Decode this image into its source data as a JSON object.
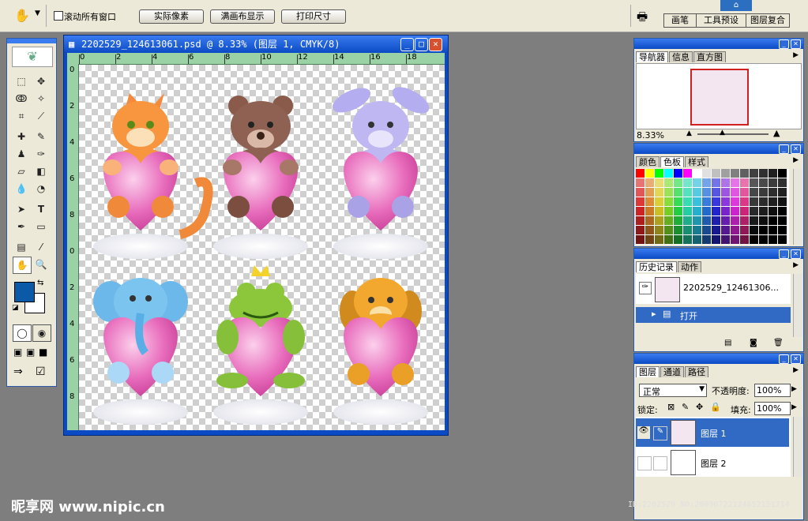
{
  "options_bar": {
    "checkbox_label": "滚动所有窗口",
    "buttons": [
      "实际像素",
      "满画布显示",
      "打印尺寸"
    ],
    "well_tabs": [
      "画笔",
      "工具预设",
      "图层复合"
    ]
  },
  "document": {
    "title": "2202529_124613061.psd @ 8.33% (图层 1, CMYK/8)",
    "ruler_top_labels": [
      "0",
      "2",
      "4",
      "6",
      "8",
      "10",
      "12",
      "14",
      "16",
      "18"
    ],
    "ruler_left_labels": [
      "0",
      "2",
      "4",
      "6",
      "8",
      "10",
      "12",
      "14",
      "16",
      "18"
    ]
  },
  "navigator": {
    "tabs": [
      "导航器",
      "信息",
      "直方图"
    ],
    "zoom": "8.33%"
  },
  "color_panel": {
    "tabs": [
      "颜色",
      "色板",
      "样式"
    ]
  },
  "history_panel": {
    "tabs": [
      "历史记录",
      "动作"
    ],
    "snapshot_name": "2202529_12461306...",
    "step_label": "打开"
  },
  "layers_panel": {
    "tabs": [
      "图层",
      "通道",
      "路径"
    ],
    "blend_mode": "正常",
    "opacity_label": "不透明度:",
    "opacity_value": "100%",
    "lock_label": "锁定:",
    "fill_label": "填充:",
    "fill_value": "100%",
    "layers": [
      {
        "name": "图层 1"
      },
      {
        "name": "图层 2"
      }
    ]
  },
  "watermark": "昵享网 www.nipic.cn",
  "id_text": "ID:2202529 NO:20090722124652151714",
  "colors": {
    "foreground": "#0a5aa8",
    "background": "#ffffff",
    "titlebar": "#0a4ac4",
    "ruler": "#9ad2a6"
  }
}
